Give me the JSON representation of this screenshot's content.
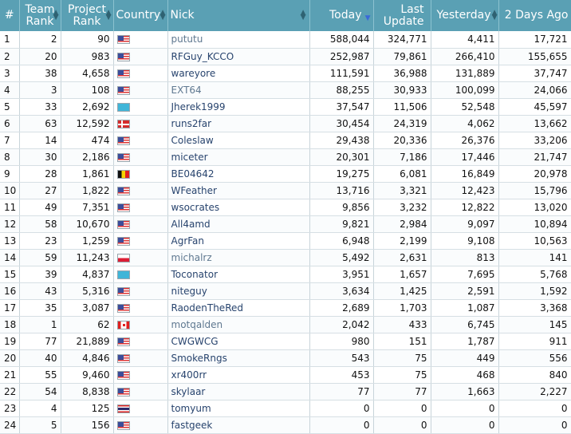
{
  "headers": {
    "num": "#",
    "team_rank": "Team Rank",
    "project_rank": "Project Rank",
    "country": "Country",
    "nick": "Nick",
    "today": "Today",
    "last_update": "Last Update",
    "yesterday": "Yesterday",
    "two_days_ago": "2 Days Ago"
  },
  "sort": {
    "column": "today",
    "direction": "descending"
  },
  "rows": [
    {
      "num": "1",
      "team_rank": "2",
      "project_rank": "90",
      "country": "US",
      "nick": "pututu",
      "today": "588,044",
      "last_update": "324,771",
      "yesterday": "4,411",
      "two_days_ago": "17,721"
    },
    {
      "num": "2",
      "team_rank": "20",
      "project_rank": "983",
      "country": "US",
      "nick": "RFGuy_KCCO",
      "today": "252,987",
      "last_update": "79,861",
      "yesterday": "266,410",
      "two_days_ago": "155,655"
    },
    {
      "num": "3",
      "team_rank": "38",
      "project_rank": "4,658",
      "country": "US",
      "nick": "wareyore",
      "today": "111,591",
      "last_update": "36,988",
      "yesterday": "131,889",
      "two_days_ago": "37,747"
    },
    {
      "num": "4",
      "team_rank": "3",
      "project_rank": "108",
      "country": "US",
      "nick": "EXT64",
      "today": "88,255",
      "last_update": "30,933",
      "yesterday": "100,099",
      "two_days_ago": "24,066"
    },
    {
      "num": "5",
      "team_rank": "33",
      "project_rank": "2,692",
      "country": "KZ",
      "nick": "Jherek1999",
      "today": "37,547",
      "last_update": "11,506",
      "yesterday": "52,548",
      "two_days_ago": "45,597"
    },
    {
      "num": "6",
      "team_rank": "63",
      "project_rank": "12,592",
      "country": "DK",
      "nick": "runs2far",
      "today": "30,454",
      "last_update": "24,319",
      "yesterday": "4,062",
      "two_days_ago": "13,662"
    },
    {
      "num": "7",
      "team_rank": "14",
      "project_rank": "474",
      "country": "US",
      "nick": "Coleslaw",
      "today": "29,438",
      "last_update": "20,336",
      "yesterday": "26,376",
      "two_days_ago": "33,206"
    },
    {
      "num": "8",
      "team_rank": "30",
      "project_rank": "2,186",
      "country": "US",
      "nick": "miceter",
      "today": "20,301",
      "last_update": "7,186",
      "yesterday": "17,446",
      "two_days_ago": "21,747"
    },
    {
      "num": "9",
      "team_rank": "28",
      "project_rank": "1,861",
      "country": "BE",
      "nick": "BE04642",
      "today": "19,275",
      "last_update": "6,081",
      "yesterday": "16,849",
      "two_days_ago": "20,978"
    },
    {
      "num": "10",
      "team_rank": "27",
      "project_rank": "1,822",
      "country": "US",
      "nick": "WFeather",
      "today": "13,716",
      "last_update": "3,321",
      "yesterday": "12,423",
      "two_days_ago": "15,796"
    },
    {
      "num": "11",
      "team_rank": "49",
      "project_rank": "7,351",
      "country": "US",
      "nick": "wsocrates",
      "today": "9,856",
      "last_update": "3,232",
      "yesterday": "12,822",
      "two_days_ago": "13,020"
    },
    {
      "num": "12",
      "team_rank": "58",
      "project_rank": "10,670",
      "country": "US",
      "nick": "All4amd",
      "today": "9,821",
      "last_update": "2,984",
      "yesterday": "9,097",
      "two_days_ago": "10,894"
    },
    {
      "num": "13",
      "team_rank": "23",
      "project_rank": "1,259",
      "country": "US",
      "nick": "AgrFan",
      "today": "6,948",
      "last_update": "2,199",
      "yesterday": "9,108",
      "two_days_ago": "10,563"
    },
    {
      "num": "14",
      "team_rank": "59",
      "project_rank": "11,243",
      "country": "PL",
      "nick": "michalrz",
      "today": "5,492",
      "last_update": "2,631",
      "yesterday": "813",
      "two_days_ago": "141"
    },
    {
      "num": "15",
      "team_rank": "39",
      "project_rank": "4,837",
      "country": "KZ",
      "nick": "Toconator",
      "today": "3,951",
      "last_update": "1,657",
      "yesterday": "7,695",
      "two_days_ago": "5,768"
    },
    {
      "num": "16",
      "team_rank": "43",
      "project_rank": "5,316",
      "country": "US",
      "nick": "niteguy",
      "today": "3,634",
      "last_update": "1,425",
      "yesterday": "2,591",
      "two_days_ago": "1,592"
    },
    {
      "num": "17",
      "team_rank": "35",
      "project_rank": "3,087",
      "country": "US",
      "nick": "RaodenTheRed",
      "today": "2,689",
      "last_update": "1,703",
      "yesterday": "1,087",
      "two_days_ago": "3,368"
    },
    {
      "num": "18",
      "team_rank": "1",
      "project_rank": "62",
      "country": "CA",
      "nick": "motqalden",
      "today": "2,042",
      "last_update": "433",
      "yesterday": "6,745",
      "two_days_ago": "145"
    },
    {
      "num": "19",
      "team_rank": "77",
      "project_rank": "21,889",
      "country": "US",
      "nick": "CWGWCG",
      "today": "980",
      "last_update": "151",
      "yesterday": "1,787",
      "two_days_ago": "911"
    },
    {
      "num": "20",
      "team_rank": "40",
      "project_rank": "4,846",
      "country": "US",
      "nick": "SmokeRngs",
      "today": "543",
      "last_update": "75",
      "yesterday": "449",
      "two_days_ago": "556"
    },
    {
      "num": "21",
      "team_rank": "55",
      "project_rank": "9,460",
      "country": "US",
      "nick": "xr400rr",
      "today": "453",
      "last_update": "75",
      "yesterday": "468",
      "two_days_ago": "840"
    },
    {
      "num": "22",
      "team_rank": "54",
      "project_rank": "8,838",
      "country": "US",
      "nick": "skylaar",
      "today": "77",
      "last_update": "77",
      "yesterday": "1,663",
      "two_days_ago": "2,227"
    },
    {
      "num": "23",
      "team_rank": "4",
      "project_rank": "125",
      "country": "TH",
      "nick": "tomyum",
      "today": "0",
      "last_update": "0",
      "yesterday": "0",
      "two_days_ago": "0"
    },
    {
      "num": "24",
      "team_rank": "5",
      "project_rank": "156",
      "country": "US",
      "nick": "fastgeek",
      "today": "0",
      "last_update": "0",
      "yesterday": "0",
      "two_days_ago": "0"
    }
  ],
  "muted_nicks": [
    "pututu",
    "EXT64",
    "michalrz",
    "motqalden"
  ]
}
